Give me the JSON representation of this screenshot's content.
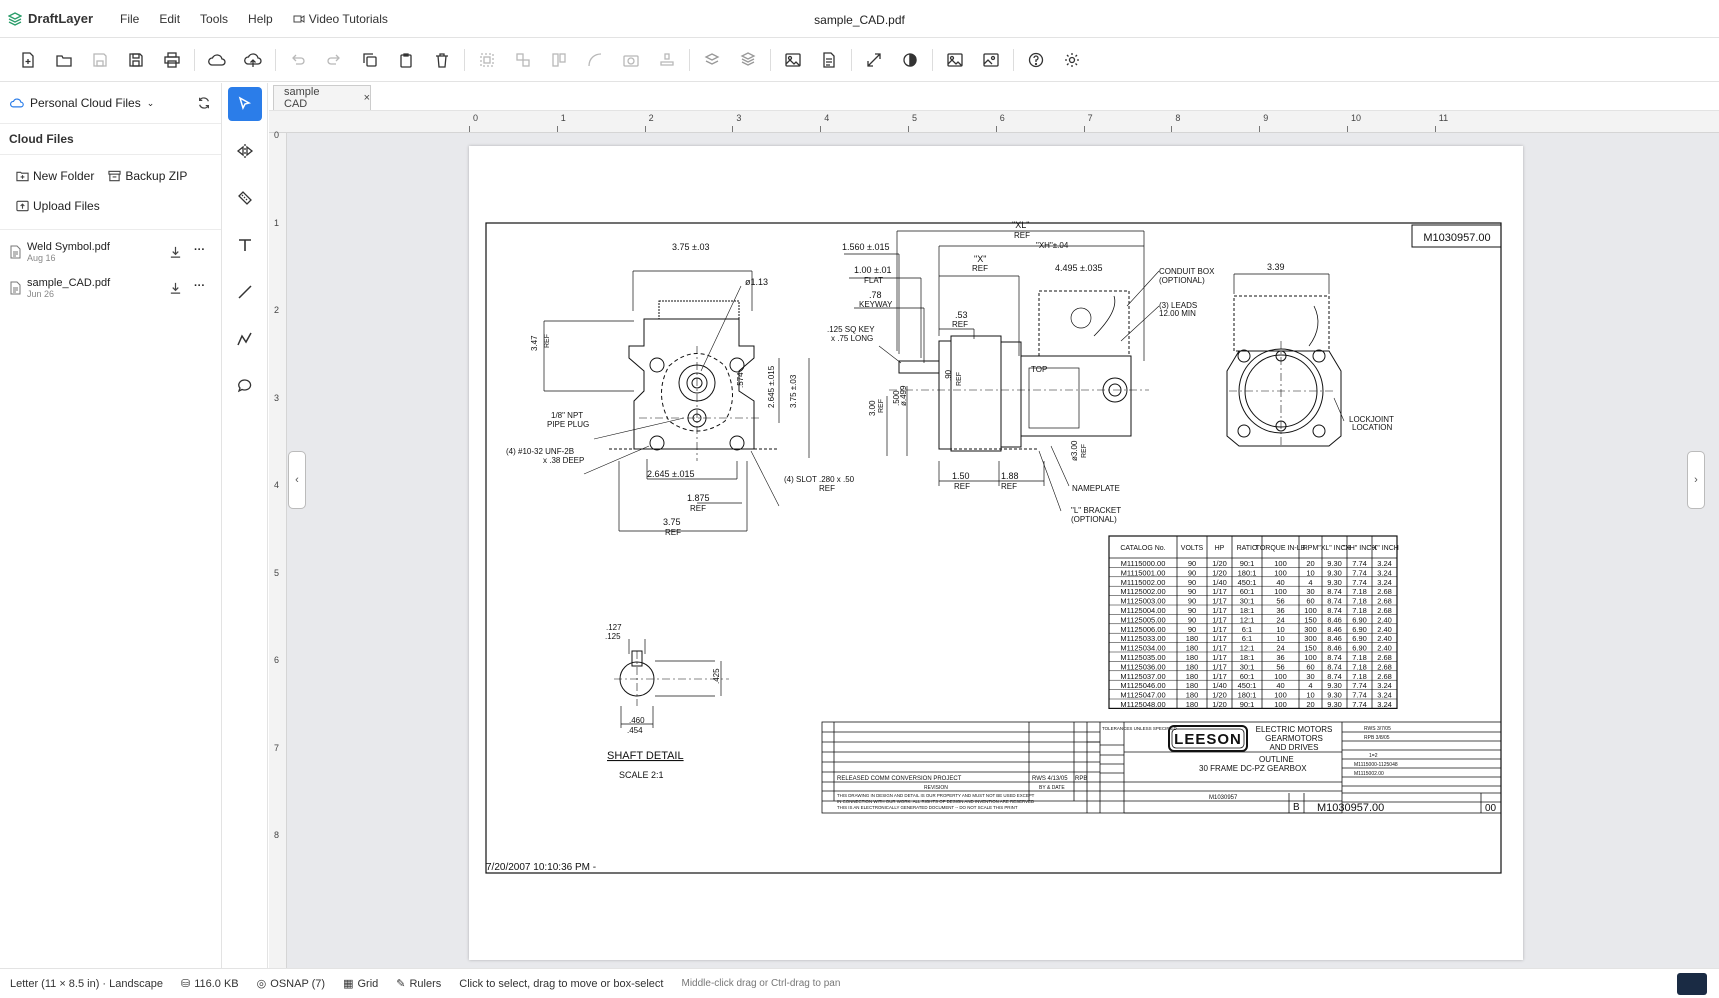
{
  "app": {
    "name": "DraftLayer",
    "document_title": "sample_CAD.pdf"
  },
  "menu": [
    "File",
    "Edit",
    "Tools",
    "Help"
  ],
  "menu_tutorials": "Video Tutorials",
  "sidebar": {
    "storage_label": "Personal Cloud Files",
    "section_title": "Cloud Files",
    "new_folder": "New Folder",
    "backup_zip": "Backup ZIP",
    "upload_files": "Upload Files",
    "files": [
      {
        "name": "Weld Symbol.pdf",
        "date": "Aug 16"
      },
      {
        "name": "sample_CAD.pdf",
        "date": "Jun 26"
      }
    ]
  },
  "tab": {
    "label": "sample CAD",
    "close": "×"
  },
  "rulers": {
    "h": [
      "0",
      "1",
      "2",
      "3",
      "4",
      "5",
      "6",
      "7",
      "8",
      "9",
      "10",
      "11"
    ],
    "v": [
      "0",
      "1",
      "2",
      "3",
      "4",
      "5",
      "6",
      "7",
      "8"
    ]
  },
  "drawing": {
    "drawing_no": "M1030957.00",
    "timestamp": "7/20/2007 10:10:36 PM -",
    "shaft_title": "SHAFT DETAIL",
    "shaft_scale": "SCALE 2:1",
    "dims": {
      "d375": "3.75 ±.03",
      "dia": "ø1.13",
      "d347": "3.47",
      "ref": "REF",
      "npt1": "1/8\" NPT",
      "npt2": "PIPE PLUG",
      "unf1": "(4) #10-32 UNF-2B",
      "unf2": "x .38 DEEP",
      "d2645": "2.645 ±.015",
      "d1875": "1.875",
      "d375b": "3.75",
      "slot": "(4) SLOT .280 x .50",
      "d574": ".574",
      "d2645v": "2.645 ±.015",
      "d375v": "3.75 ±.03",
      "xl": "\"XL\"",
      "xh": "\"XH\"±.04",
      "x": "\"X\"",
      "d1560": "1.560 ±.015",
      "d100": "1.00 ±.01",
      "flat": "FLAT",
      "d78": ".78",
      "keyway": "KEYWAY",
      "d4495": "4.495 ±.035",
      "key1": ".125 SQ KEY",
      "key2": "x .75 LONG",
      "d53": ".53",
      "conduit1": "CONDUIT BOX",
      "conduit2": "(OPTIONAL)",
      "leads1": "(3) LEADS",
      "leads2": "12.00 MIN",
      "top": "TOP",
      "d300": "3.00",
      "d500": ".500",
      "d499": "ø.499",
      "d90": ".90",
      "d150": "1.50",
      "d188": "1.88",
      "d300b": "ø3.00",
      "nameplate": "NAMEPLATE",
      "bracket1": "\"L\" BRACKET",
      "bracket2": "(OPTIONAL)",
      "d339": "3.39",
      "lock1": "LOCKJOINT",
      "lock2": "LOCATION",
      "s127": ".127",
      "s125": ".125",
      "s425": ".425",
      "s460": ".460",
      "s454": ".454"
    },
    "table": {
      "headers": [
        "CATALOG No.",
        "VOLTS",
        "HP",
        "RATIO",
        "TORQUE IN-LB",
        "RPM",
        "\"XL\" INCH",
        "\"XH\" INCH",
        "\"X\" INCH"
      ],
      "rows": [
        [
          "M1115000.00",
          "90",
          "1/20",
          "90:1",
          "100",
          "20",
          "9.30",
          "7.74",
          "3.24"
        ],
        [
          "M1115001.00",
          "90",
          "1/20",
          "180:1",
          "100",
          "10",
          "9.30",
          "7.74",
          "3.24"
        ],
        [
          "M1115002.00",
          "90",
          "1/40",
          "450:1",
          "40",
          "4",
          "9.30",
          "7.74",
          "3.24"
        ],
        [
          "M1125002.00",
          "90",
          "1/17",
          "60:1",
          "100",
          "30",
          "8.74",
          "7.18",
          "2.68"
        ],
        [
          "M1125003.00",
          "90",
          "1/17",
          "30:1",
          "56",
          "60",
          "8.74",
          "7.18",
          "2.68"
        ],
        [
          "M1125004.00",
          "90",
          "1/17",
          "18:1",
          "36",
          "100",
          "8.74",
          "7.18",
          "2.68"
        ],
        [
          "M1125005.00",
          "90",
          "1/17",
          "12:1",
          "24",
          "150",
          "8.46",
          "6.90",
          "2.40"
        ],
        [
          "M1125006.00",
          "90",
          "1/17",
          "6:1",
          "10",
          "300",
          "8.46",
          "6.90",
          "2.40"
        ],
        [
          "M1125033.00",
          "180",
          "1/17",
          "6:1",
          "10",
          "300",
          "8.46",
          "6.90",
          "2.40"
        ],
        [
          "M1125034.00",
          "180",
          "1/17",
          "12:1",
          "24",
          "150",
          "8.46",
          "6.90",
          "2.40"
        ],
        [
          "M1125035.00",
          "180",
          "1/17",
          "18:1",
          "36",
          "100",
          "8.74",
          "7.18",
          "2.68"
        ],
        [
          "M1125036.00",
          "180",
          "1/17",
          "30:1",
          "56",
          "60",
          "8.74",
          "7.18",
          "2.68"
        ],
        [
          "M1125037.00",
          "180",
          "1/17",
          "60:1",
          "100",
          "30",
          "8.74",
          "7.18",
          "2.68"
        ],
        [
          "M1125046.00",
          "180",
          "1/40",
          "450:1",
          "40",
          "4",
          "9.30",
          "7.74",
          "3.24"
        ],
        [
          "M1125047.00",
          "180",
          "1/20",
          "180:1",
          "100",
          "10",
          "9.30",
          "7.74",
          "3.24"
        ],
        [
          "M1125048.00",
          "180",
          "1/20",
          "90:1",
          "100",
          "20",
          "9.30",
          "7.74",
          "3.24"
        ]
      ]
    },
    "title_block": {
      "logo": "LEESON",
      "company1": "ELECTRIC MOTORS",
      "company2": "GEARMOTORS",
      "company3": "AND DRIVES",
      "title1": "OUTLINE",
      "title2": "30 FRAME DC-PZ GEARBOX",
      "rev_text": "RELEASED COMM CONVERSION PROJECT",
      "rev_by": "RWS  4/13/05",
      "rev_chk": "RPB",
      "rev_col1": "REVISION",
      "rev_col2": "BY & DATE",
      "drawn": "RWS  3/7/05",
      "chk": "RPB  3/8/05",
      "scale": "1=2",
      "ref": "M1115000-1125048",
      "fmf": "M1115002.00",
      "cad_file": "M1030957",
      "size": "B",
      "rev": "00",
      "tolerances": "TOLERANCES UNLESS SPECIFIED",
      "disclaimer1": "THIS DRAWING IN DESIGN AND DETAIL IS OUR PROPERTY AND MUST NOT BE USED EXCEPT",
      "disclaimer2": "IN CONNECTION WITH OUR WORK. ALL RIGHTS OF DESIGN AND INVENTION ARE RESERVED",
      "disclaimer3": "THIS IS AN ELECTRONICALLY GENERATED DOCUMENT -- DO NOT SCALE THIS PRINT"
    }
  },
  "status": {
    "paper": "Letter (11 × 8.5 in) · Landscape",
    "size": "116.0 KB",
    "osnap": "OSNAP (7)",
    "grid": "Grid",
    "rulers": "Rulers",
    "hint1": "Click to select, drag to move or box-select",
    "hint2": "Middle-click drag or Ctrl-drag to pan"
  },
  "colors": {
    "accent": "#2b7de9",
    "canvas": "#e8e9ec"
  }
}
